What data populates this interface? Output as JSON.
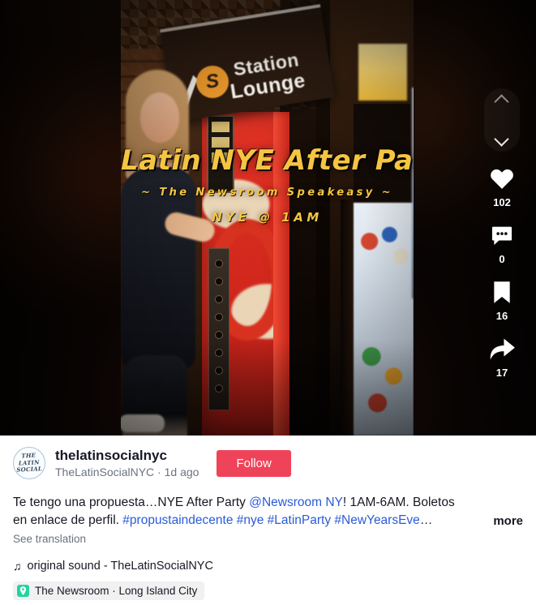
{
  "video": {
    "overlay_title": "Latin NYE After Party",
    "overlay_subtitle": "~ The Newsroom Speakeasy ~",
    "overlay_time": "NYE @ 1AM",
    "scene_sign_line1": "Station",
    "scene_sign_line2": "Lounge"
  },
  "rail": {
    "prev_icon": "chevron-up-icon",
    "next_icon": "chevron-down-icon",
    "like": {
      "icon": "heart-icon",
      "count": "102"
    },
    "comment": {
      "icon": "comment-icon",
      "count": "0"
    },
    "bookmark": {
      "icon": "bookmark-icon",
      "count": "16"
    },
    "share": {
      "icon": "share-icon",
      "count": "17"
    }
  },
  "author": {
    "avatar_line1": "THE",
    "avatar_line2": "LATIN",
    "avatar_line3": "SOCIAL",
    "username": "thelatinsocialnyc",
    "handle_and_time": "TheLatinSocialNYC · 1d ago",
    "follow_label": "Follow",
    "follow_color": "#ef4359"
  },
  "caption": {
    "part1": "Te tengo una propuesta…NYE After Party ",
    "mention": "@Newsroom NY",
    "part2": "! 1AM-6AM. Boletos en enlace de perfil. ",
    "hashtags": "#propustaindecente #nye #LatinParty #NewYearsEve",
    "ellipsis": "…",
    "more_label": "more",
    "translation_label": "See translation",
    "link_color": "#2a5bd7"
  },
  "sound": {
    "icon": "music-note-icon",
    "label": "original sound - TheLatinSocialNYC"
  },
  "location": {
    "icon": "map-pin-icon",
    "label": "The Newsroom · Long Island City",
    "badge_color": "#20d5a0"
  }
}
